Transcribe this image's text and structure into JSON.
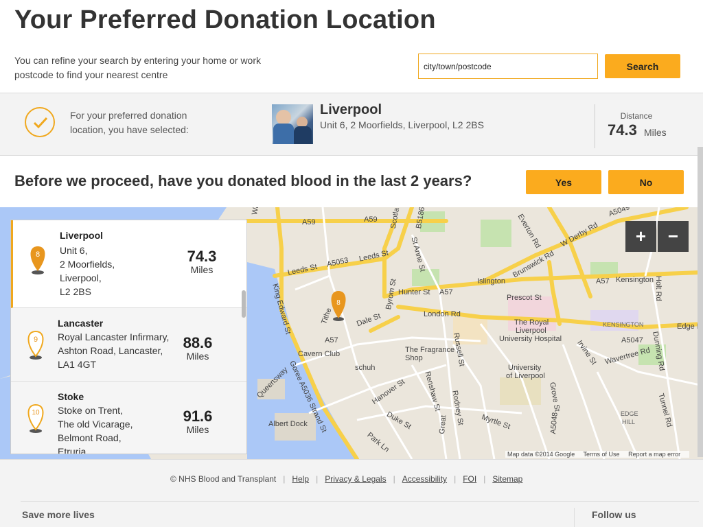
{
  "header": {
    "title": "Your Preferred Donation Location",
    "intro": "You can refine your search by entering your home or work postcode to find your nearest centre",
    "search_placeholder": "city/town/postcode",
    "search_label": "Search"
  },
  "selected": {
    "label": "For your preferred donation location, you have selected:",
    "city": "Liverpool",
    "address": "Unit 6, 2 Moorfields, Liverpool, L2 2BS",
    "distance_label": "Distance",
    "distance_value": "74.3",
    "distance_unit": "Miles"
  },
  "question": {
    "text": "Before we proceed, have you donated blood in the last 2 years?",
    "yes_label": "Yes",
    "no_label": "No"
  },
  "map": {
    "zoom_in": "+",
    "zoom_out": "−",
    "attribution": "Map data ©2014 Google",
    "terms": "Terms of Use",
    "report": "Report a map error",
    "marker_number": "8",
    "labels": {
      "waterloo": "Waterloo Rd",
      "a59_a": "A59",
      "a59_b": "A59",
      "scotland": "Scotla",
      "b5186": "B5186",
      "everton": "Everton Rd",
      "wderby": "W Derby Rd",
      "a5049": "A5049",
      "leeds1": "Leeds St",
      "a5053": "A5053",
      "leeds2": "Leeds St",
      "stanne": "St Anne St",
      "brunswick": "Brunswick Rd",
      "islington": "Islington",
      "a57a": "A57",
      "kensington": "Kensington",
      "hunter": "Hunter St",
      "a57b": "A57",
      "prescot": "Prescot St",
      "holt": "Holt Rd",
      "tithe": "Tithe",
      "dale": "Dale St",
      "byrom": "Byrom St",
      "london": "London Rd",
      "royal1": "The Royal",
      "royal2": "Liverpool",
      "royal3": "University Hospital",
      "kens_area": "KENSINGTON",
      "edge": "Edge L",
      "a5047": "A5047",
      "a57c": "A57",
      "kingedward": "King Edward St",
      "cavern": "Cavern Club",
      "fragrance1": "The Fragrance",
      "fragrance2": "Shop",
      "russell": "Russell St",
      "irvine": "Irvine St",
      "dunning": "Dunning Rd",
      "schuh": "schuh",
      "uni1": "University",
      "uni2": "of Liverpool",
      "wavertree": "Wavertree Rd",
      "queensway": "Queensway",
      "goree": "Goree A5036 Strand St",
      "hanover": "Hanover St",
      "renshaw": "Renshaw St",
      "duke": "Duke St",
      "rodney": "Rodney St",
      "myrtle": "Myrtle St",
      "grove": "Grove St",
      "edgehill1": "EDGE",
      "edgehill2": "HILL",
      "tunnel": "Tunnel Rd",
      "albert": "Albert Dock",
      "parkln": "Park Ln",
      "great": "Great",
      "a5048": "A5048"
    }
  },
  "results": [
    {
      "number": "8",
      "name": "Liverpool",
      "address": [
        "Unit 6,",
        "2 Moorfields,",
        "Liverpool,",
        "L2 2BS"
      ],
      "distance": "74.3",
      "unit": "Miles",
      "active": true
    },
    {
      "number": "9",
      "name": "Lancaster",
      "address": [
        "Royal Lancaster Infirmary,",
        "Ashton Road, Lancaster,",
        "LA1 4GT"
      ],
      "distance": "88.6",
      "unit": "Miles",
      "active": false
    },
    {
      "number": "10",
      "name": "Stoke",
      "address": [
        "Stoke on Trent,",
        "The old Vicarage,",
        "Belmont Road,",
        "Etruria"
      ],
      "distance": "91.6",
      "unit": "Miles",
      "active": false
    }
  ],
  "footer": {
    "copyright": "© NHS Blood and Transplant",
    "links": [
      "Help",
      "Privacy & Legals",
      "Accessibility",
      "FOI",
      "Sitemap"
    ],
    "save_more": "Save more lives",
    "follow_us": "Follow us"
  },
  "colors": {
    "accent": "#fbab1e",
    "pin": "#e8961e",
    "pin_outline": "#f0a81e"
  }
}
